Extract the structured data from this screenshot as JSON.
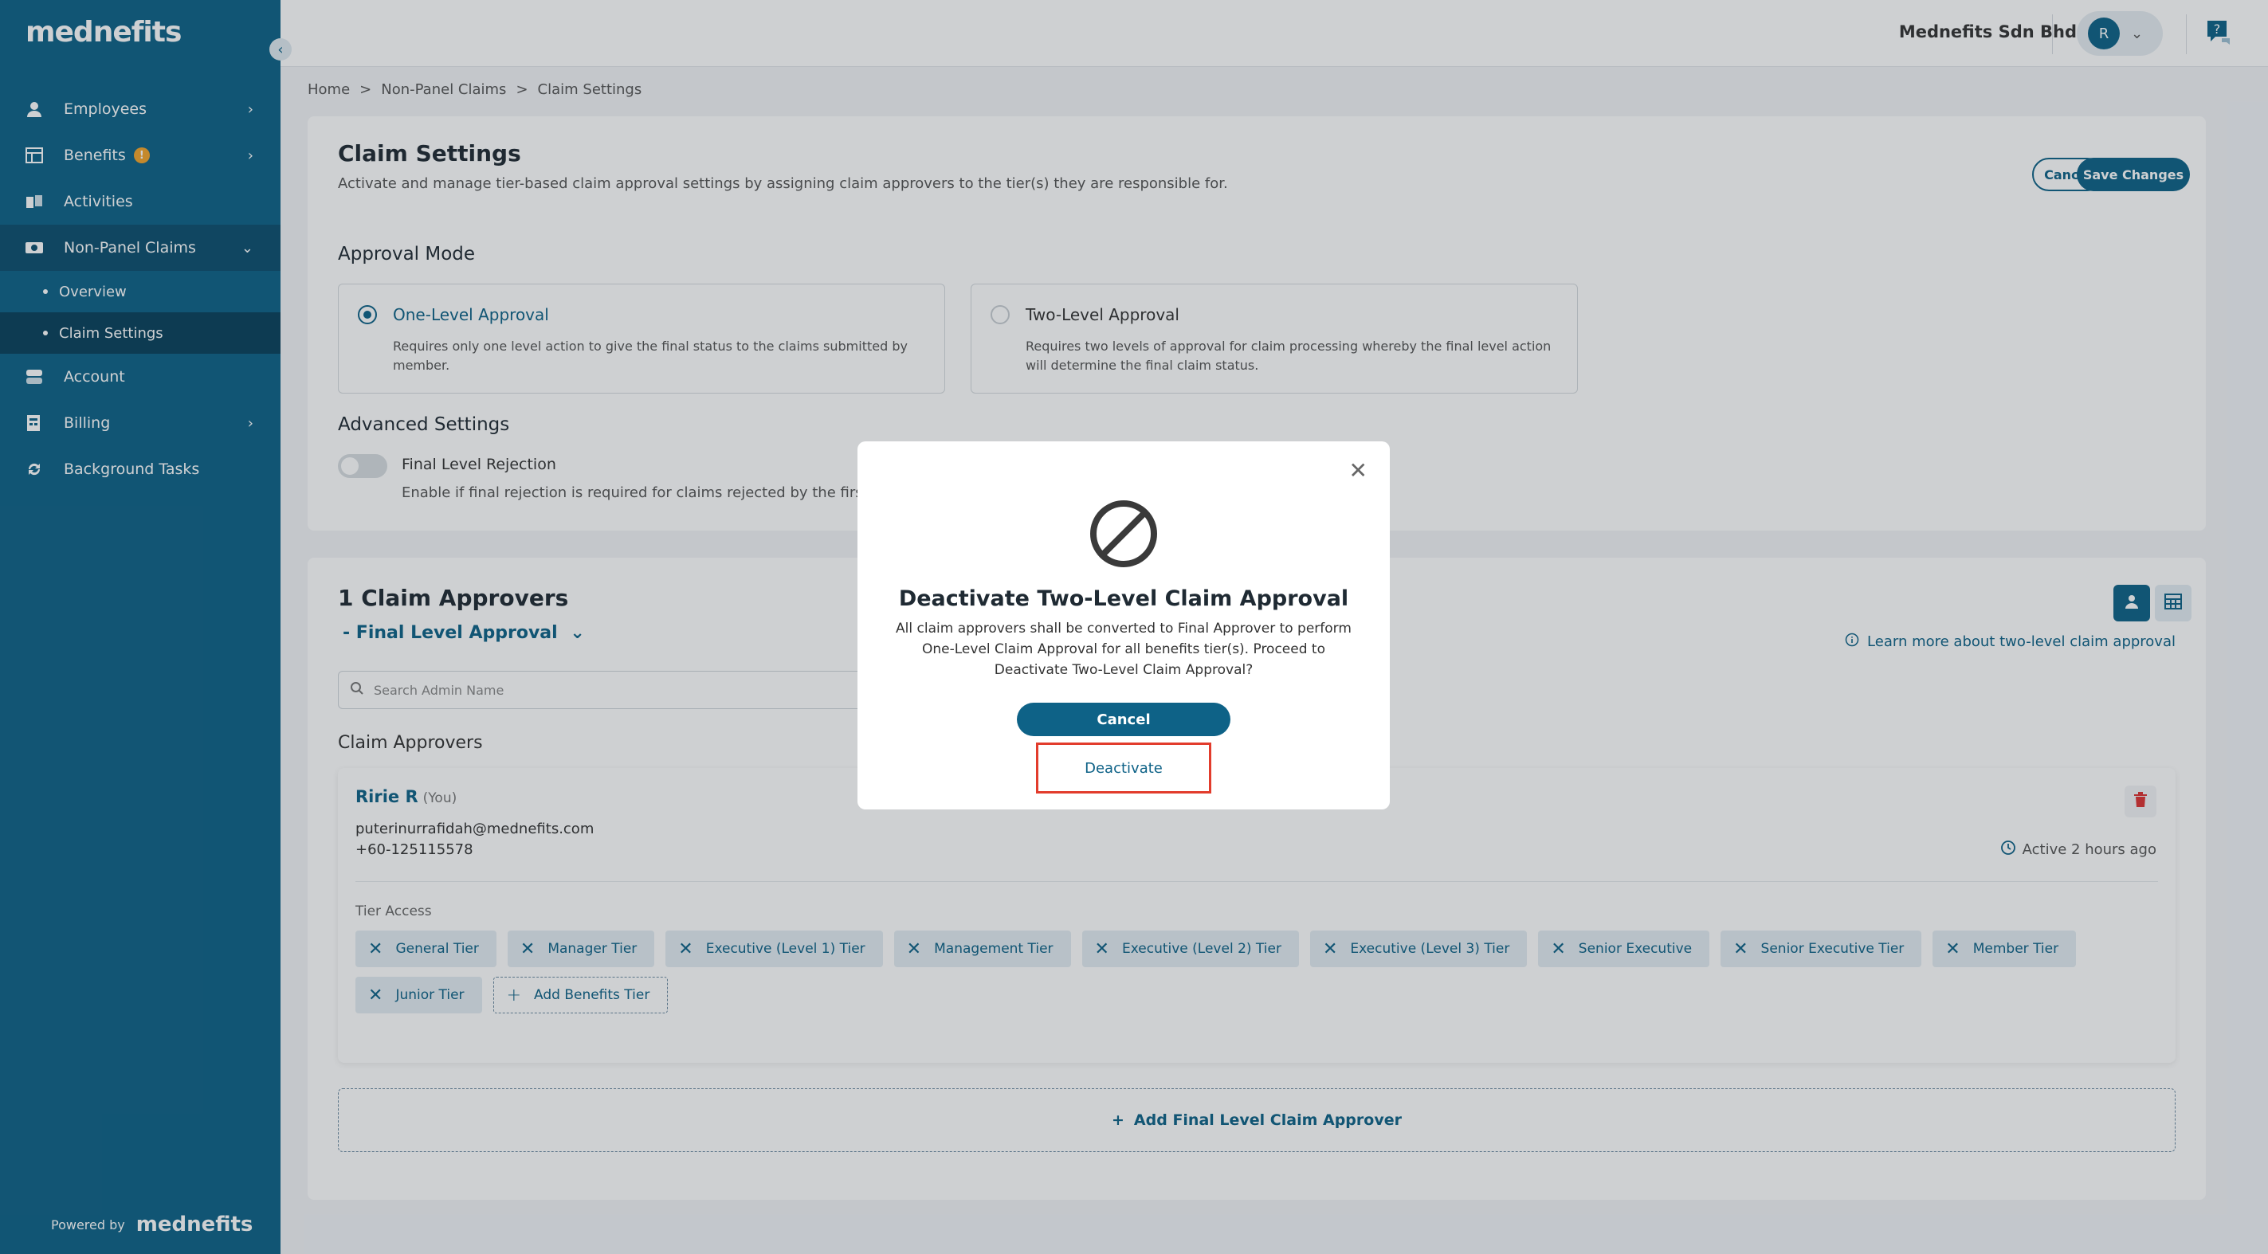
{
  "app": {
    "logo": "mednefits"
  },
  "sidebar": {
    "items": [
      {
        "label": "Employees"
      },
      {
        "label": "Benefits",
        "badge": "!"
      },
      {
        "label": "Activities"
      },
      {
        "label": "Non-Panel Claims"
      },
      {
        "label": "Account"
      },
      {
        "label": "Billing"
      },
      {
        "label": "Background Tasks"
      }
    ],
    "sub_items": [
      {
        "label": "Overview"
      },
      {
        "label": "Claim Settings"
      }
    ],
    "powered_by": "Powered by",
    "powered_logo": "mednefits"
  },
  "topbar": {
    "company": "Mednefits Sdn Bhd",
    "avatar_initial": "R"
  },
  "breadcrumb": {
    "items": [
      "Home",
      "Non-Panel Claims",
      "Claim Settings"
    ],
    "sep": ">"
  },
  "settings": {
    "title": "Claim Settings",
    "subtitle": "Activate and manage tier-based claim approval settings by assigning claim approvers to the tier(s) they are responsible for.",
    "cancel_label": "Cancel",
    "save_label": "Save Changes",
    "approval_mode_heading": "Approval Mode",
    "modes": [
      {
        "title": "One-Level Approval",
        "desc": "Requires only one level action to give the final status to the claims submitted by member.",
        "selected": true
      },
      {
        "title": "Two-Level Approval",
        "desc": "Requires two levels of approval for claim processing whereby the final level action will determine the final claim status.",
        "selected": false
      }
    ],
    "advanced_heading": "Advanced Settings",
    "toggle_label": "Final Level Rejection",
    "toggle_desc": "Enable if final rejection is required for claims rejected by the first-le"
  },
  "approvers": {
    "count_title": "1 Claim Approvers",
    "level_select": "- Final Level Approval",
    "search_placeholder": "Search Admin Name",
    "learn_more": "Learn more about two-level claim approval",
    "section_label": "Claim Approvers",
    "card": {
      "name": "Ririe R",
      "you": "(You)",
      "email": "puterinurrafidah@mednefits.com",
      "phone": "+60-125115578",
      "active": "Active 2 hours ago",
      "tier_access_label": "Tier Access",
      "tiers": [
        "General Tier",
        "Manager Tier",
        "Executive (Level 1) Tier",
        "Management Tier",
        "Executive (Level 2) Tier",
        "Executive (Level 3) Tier",
        "Senior Executive",
        "Senior Executive Tier",
        "Member Tier",
        "Junior Tier"
      ],
      "add_tier_label": "Add Benefits Tier"
    },
    "add_approver_label": "Add Final Level Claim Approver"
  },
  "modal": {
    "title": "Deactivate Two-Level Claim Approval",
    "body": "All claim approvers shall be converted to Final Approver to perform One-Level Claim Approval for all benefits tier(s). Proceed to Deactivate Two-Level Claim Approval?",
    "cancel_label": "Cancel",
    "deactivate_label": "Deactivate"
  },
  "colors": {
    "primary": "#0e6287",
    "highlight": "#e23c2c",
    "warning": "#f3a42b"
  }
}
